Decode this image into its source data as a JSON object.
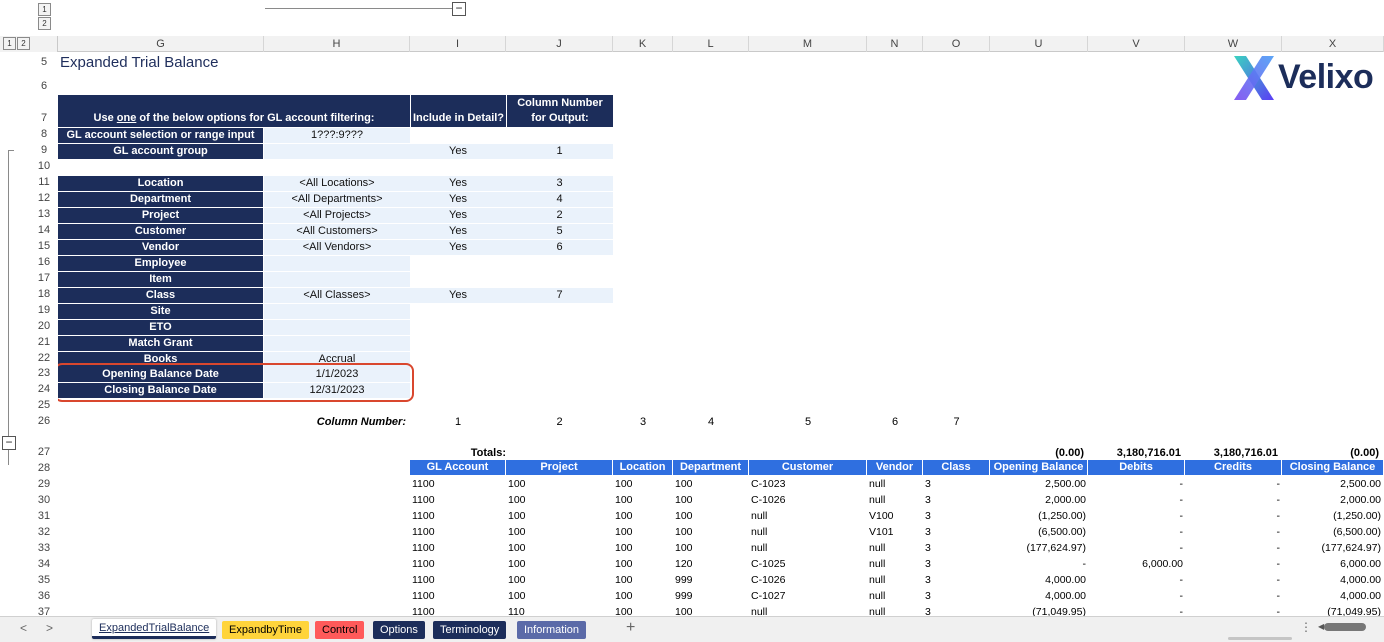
{
  "outline": {
    "levels": [
      "1",
      "2"
    ],
    "collapse": "−"
  },
  "columns": [
    "G",
    "H",
    "I",
    "J",
    "K",
    "L",
    "M",
    "N",
    "O",
    "U",
    "V",
    "W",
    "X"
  ],
  "rows": [
    "5",
    "6",
    "7",
    "8",
    "9",
    "10",
    "11",
    "12",
    "13",
    "14",
    "15",
    "16",
    "17",
    "18",
    "19",
    "20",
    "21",
    "22",
    "23",
    "24",
    "25",
    "26",
    "27",
    "28",
    "29",
    "30",
    "31",
    "32",
    "33",
    "34",
    "35",
    "36",
    "37"
  ],
  "sheet": {
    "title": "Expanded Trial Balance",
    "logo_text": "Velixo",
    "filter_header": {
      "prefix": "Use ",
      "emph": "one",
      "suffix": " of the below options for GL account filtering:"
    },
    "include_header": "Include in Detail?",
    "colnum_header": "Column Number for Output:",
    "options": [
      {
        "label": "GL account selection or range input",
        "value": "1???:9???",
        "include": "",
        "col": ""
      },
      {
        "label": "GL account group",
        "value": "",
        "include": "Yes",
        "col": "1"
      },
      {
        "label": "Location",
        "value": "<All Locations>",
        "include": "Yes",
        "col": "3"
      },
      {
        "label": "Department",
        "value": "<All Departments>",
        "include": "Yes",
        "col": "4"
      },
      {
        "label": "Project",
        "value": "<All Projects>",
        "include": "Yes",
        "col": "2"
      },
      {
        "label": "Customer",
        "value": "<All Customers>",
        "include": "Yes",
        "col": "5"
      },
      {
        "label": "Vendor",
        "value": "<All Vendors>",
        "include": "Yes",
        "col": "6"
      },
      {
        "label": "Employee",
        "value": "",
        "include": "",
        "col": ""
      },
      {
        "label": "Item",
        "value": "",
        "include": "",
        "col": ""
      },
      {
        "label": "Class",
        "value": "<All Classes>",
        "include": "Yes",
        "col": "7"
      },
      {
        "label": "Site",
        "value": "",
        "include": "",
        "col": ""
      },
      {
        "label": "ETO",
        "value": "",
        "include": "",
        "col": ""
      },
      {
        "label": "Match Grant",
        "value": "",
        "include": "",
        "col": ""
      },
      {
        "label": "Books",
        "value": "Accrual",
        "include": "",
        "col": ""
      },
      {
        "label": "Opening Balance Date",
        "value": "1/1/2023",
        "include": "",
        "col": ""
      },
      {
        "label": "Closing Balance Date",
        "value": "12/31/2023",
        "include": "",
        "col": ""
      }
    ],
    "column_number_label": "Column Number:",
    "column_numbers": [
      "1",
      "2",
      "3",
      "4",
      "5",
      "6",
      "7"
    ],
    "totals_label": "Totals:",
    "totals": {
      "opening": "(0.00)",
      "debits": "3,180,716.01",
      "credits": "3,180,716.01",
      "closing": "(0.00)"
    },
    "table_headers": [
      "GL Account",
      "Project",
      "Location",
      "Department",
      "Customer",
      "Vendor",
      "Class",
      "Opening Balance",
      "Debits",
      "Credits",
      "Closing Balance"
    ],
    "table_rows": [
      [
        "1100",
        "100",
        "100",
        "100",
        "C-1023",
        "null",
        "3",
        "2,500.00",
        "-",
        "-",
        "2,500.00"
      ],
      [
        "1100",
        "100",
        "100",
        "100",
        "C-1026",
        "null",
        "3",
        "2,000.00",
        "-",
        "-",
        "2,000.00"
      ],
      [
        "1100",
        "100",
        "100",
        "100",
        "null",
        "V100",
        "3",
        "(1,250.00)",
        "-",
        "-",
        "(1,250.00)"
      ],
      [
        "1100",
        "100",
        "100",
        "100",
        "null",
        "V101",
        "3",
        "(6,500.00)",
        "-",
        "-",
        "(6,500.00)"
      ],
      [
        "1100",
        "100",
        "100",
        "100",
        "null",
        "null",
        "3",
        "(177,624.97)",
        "-",
        "-",
        "(177,624.97)"
      ],
      [
        "1100",
        "100",
        "100",
        "120",
        "C-1025",
        "null",
        "3",
        "-",
        "6,000.00",
        "-",
        "6,000.00"
      ],
      [
        "1100",
        "100",
        "100",
        "999",
        "C-1026",
        "null",
        "3",
        "4,000.00",
        "-",
        "-",
        "4,000.00"
      ],
      [
        "1100",
        "100",
        "100",
        "999",
        "C-1027",
        "null",
        "3",
        "4,000.00",
        "-",
        "-",
        "4,000.00"
      ],
      [
        "1100",
        "110",
        "100",
        "100",
        "null",
        "null",
        "3",
        "(71,049.95)",
        "-",
        "-",
        "(71,049.95)"
      ]
    ]
  },
  "tabs": [
    {
      "label": "ExpandedTrialBalance",
      "bg": "#ffffff",
      "fg": "#1c2d5a"
    },
    {
      "label": "ExpandbyTime",
      "bg": "#ffd43b",
      "fg": "#000000"
    },
    {
      "label": "Control",
      "bg": "#ff5a5a",
      "fg": "#000000"
    },
    {
      "label": "Options",
      "bg": "#1c2d5a",
      "fg": "#ffffff"
    },
    {
      "label": "Terminology",
      "bg": "#1c2d5a",
      "fg": "#ffffff"
    },
    {
      "label": "Information",
      "bg": "#5b6aa8",
      "fg": "#ffffff"
    }
  ],
  "tab_nav": {
    "prev": "<",
    "next": ">",
    "add": "+",
    "more": "⋮"
  },
  "colors": {
    "navy": "#1c2d5a",
    "table_header_blue": "#2f6fe0",
    "highlight_red": "#d9472e",
    "pale_cell": "#eaf2fb"
  }
}
